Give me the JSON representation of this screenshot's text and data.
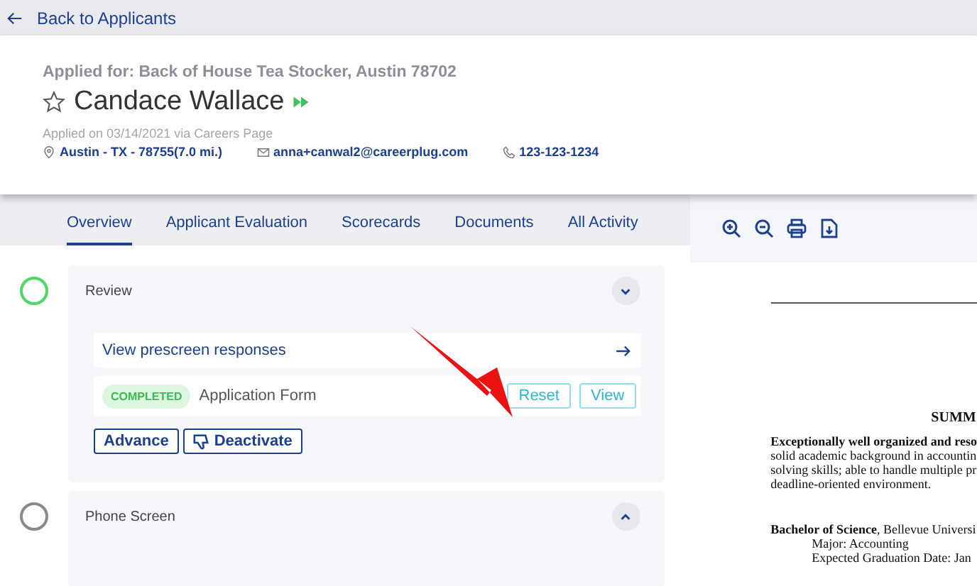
{
  "back_link": {
    "label": "Back to Applicants"
  },
  "header": {
    "applied_for": "Applied for: Back of House Tea Stocker, Austin 78702",
    "name": "Candace Wallace",
    "starred": false,
    "applied_on": "Applied on 03/14/2021 via Careers Page",
    "location": "Austin - TX - 78755(7.0 mi.)",
    "email": "anna+canwal2@careerplug.com",
    "phone": "123-123-1234"
  },
  "tabs": [
    {
      "label": "Overview",
      "selected": true
    },
    {
      "label": "Applicant Evaluation",
      "selected": false
    },
    {
      "label": "Scorecards",
      "selected": false
    },
    {
      "label": "Documents",
      "selected": false
    },
    {
      "label": "All Activity",
      "selected": false
    }
  ],
  "stages": [
    {
      "title": "Review",
      "expanded": true,
      "color": "#4cd964",
      "link": "View prescreen responses",
      "form": {
        "status": "COMPLETED",
        "name": "Application Form",
        "buttons": [
          "Reset",
          "View"
        ]
      },
      "actions": [
        "Advance",
        "Deactivate"
      ]
    },
    {
      "title": "Phone Screen",
      "expanded": false,
      "color": "#8a8a8a"
    }
  ],
  "document": {
    "lines": [
      {
        "kind": "heading",
        "text": "SUMM"
      },
      {
        "kind": "bold",
        "text": "Exceptionally well organized and reso"
      },
      {
        "kind": "plain",
        "text": "solid academic background in accountin"
      },
      {
        "kind": "plain",
        "text": "solving skills; able to handle multiple pr"
      },
      {
        "kind": "plain",
        "text": "deadline-oriented environment."
      },
      {
        "kind": "gap",
        "text": "**Bachelor of Science**, Bellevue Universi"
      },
      {
        "kind": "indent",
        "text": "Major:  Accounting"
      },
      {
        "kind": "indent",
        "text": "Expected Graduation Date:  Jan"
      }
    ]
  }
}
